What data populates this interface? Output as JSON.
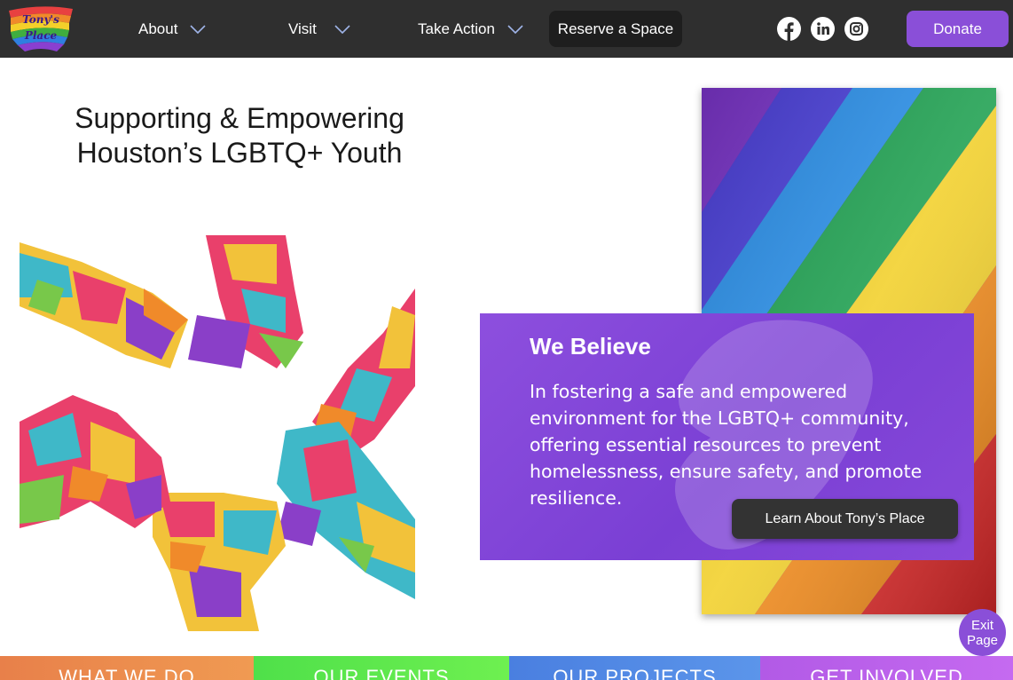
{
  "nav": {
    "logo_text_line1": "Tony's",
    "logo_text_line2": "Place",
    "items": [
      {
        "label": "About"
      },
      {
        "label": "Visit"
      },
      {
        "label": "Take Action"
      }
    ],
    "reserve_label": "Reserve a Space",
    "social_icons": [
      "facebook-icon",
      "linkedin-icon",
      "instagram-icon"
    ],
    "donate_label": "Donate"
  },
  "hero": {
    "title_line1": "Supporting & Empowering",
    "title_line2": "Houston’s LGBTQ+ Youth"
  },
  "believe": {
    "title": "We Believe",
    "text": "In fostering a safe and empowered environment for the LGBTQ+ community, offering essential resources to prevent homelessness, ensure safety, and promote resilience.",
    "button_label": "Learn About Tony’s Place"
  },
  "exit": {
    "line1": "Exit",
    "line2": "Page"
  },
  "tiles": [
    {
      "label": "WHAT WE DO"
    },
    {
      "label": "OUR EVENTS"
    },
    {
      "label": "OUR PROJECTS"
    },
    {
      "label": "GET INVOLVED"
    }
  ],
  "colors": {
    "nav_bg": "#2f2f2f",
    "accent_purple": "#8a4fd8",
    "tile_orange": "#e8804a",
    "tile_green": "#4fe04a",
    "tile_blue": "#4a7fe0",
    "tile_purple": "#b25ae6"
  }
}
